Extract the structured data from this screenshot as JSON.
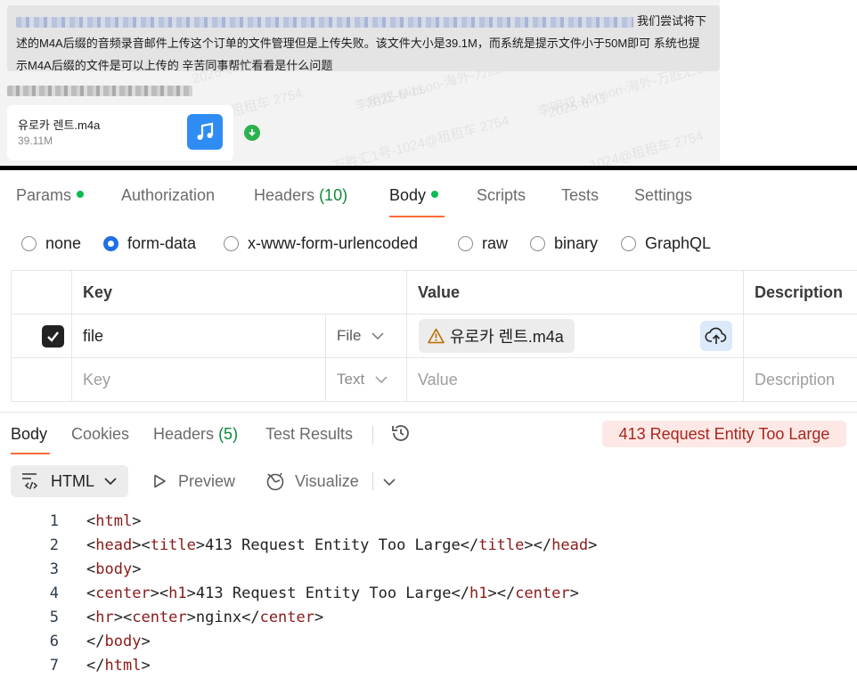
{
  "chat": {
    "message_text_line1": "我们尝试将下",
    "message_text_line2": "述的M4A后缀的音频录音邮件上传这个订单的文件管理但是上传失败。该文件大小是39.1M，而系统是提示文件小于50M即可 系统也提",
    "message_text_line3": "示M4A后缀的文件是可以上传的 辛苦同事帮忙看看是什么问题",
    "attachment": {
      "file_name": "유로카 렌트.m4a",
      "file_size": "39.11M",
      "icon": "music-note-icon",
      "download_icon": "download-icon"
    },
    "watermarks": [
      "李明双-Minson-海外-万胜汇1号",
      "2025-6-11",
      "万胜汇1号-1024@租租车 2754",
      "1024@租租车 2754"
    ]
  },
  "request": {
    "tabs": [
      {
        "label": "Params",
        "count": "",
        "dot": true,
        "active": false
      },
      {
        "label": "Authorization",
        "count": "",
        "dot": false,
        "active": false
      },
      {
        "label": "Headers",
        "count": "(10)",
        "dot": false,
        "active": false
      },
      {
        "label": "Body",
        "count": "",
        "dot": true,
        "active": true
      },
      {
        "label": "Scripts",
        "count": "",
        "dot": false,
        "active": false
      },
      {
        "label": "Tests",
        "count": "",
        "dot": false,
        "active": false
      },
      {
        "label": "Settings",
        "count": "",
        "dot": false,
        "active": false
      }
    ],
    "body_types": [
      {
        "label": "none",
        "selected": false
      },
      {
        "label": "form-data",
        "selected": true
      },
      {
        "label": "x-www-form-urlencoded",
        "selected": false
      },
      {
        "label": "raw",
        "selected": false
      },
      {
        "label": "binary",
        "selected": false
      },
      {
        "label": "GraphQL",
        "selected": false
      }
    ],
    "table": {
      "headers": {
        "key": "Key",
        "value": "Value",
        "description": "Description"
      },
      "rows": [
        {
          "checked": true,
          "key": "file",
          "type": "File",
          "value": "유로카 렌트.m4a",
          "value_icon": "warning-icon",
          "description": ""
        }
      ],
      "new_row": {
        "key_placeholder": "Key",
        "type": "Text",
        "value_placeholder": "Value",
        "description_placeholder": "Description"
      }
    }
  },
  "response": {
    "tabs": [
      {
        "label": "Body",
        "count": "",
        "active": true
      },
      {
        "label": "Cookies",
        "count": "",
        "active": false
      },
      {
        "label": "Headers",
        "count": "(5)",
        "active": false
      },
      {
        "label": "Test Results",
        "count": "",
        "active": false
      }
    ],
    "status": "413 Request Entity Too Large",
    "status_color": "#a8261d",
    "format": "HTML",
    "preview_label": "Preview",
    "visualize_label": "Visualize",
    "code_lines": [
      {
        "n": "1",
        "parts": [
          [
            "t",
            "<html>"
          ]
        ]
      },
      {
        "n": "2",
        "parts": [
          [
            "t",
            "<head><title>"
          ],
          [
            "x",
            "413 Request Entity Too Large"
          ],
          [
            "t",
            "</title></head>"
          ]
        ]
      },
      {
        "n": "3",
        "parts": [
          [
            "t",
            "<body>"
          ]
        ]
      },
      {
        "n": "4",
        "parts": [
          [
            "t",
            "<center><h1>"
          ],
          [
            "x",
            "413 Request Entity Too Large"
          ],
          [
            "t",
            "</h1></center>"
          ]
        ]
      },
      {
        "n": "5",
        "parts": [
          [
            "t",
            "<hr><center>"
          ],
          [
            "x",
            "nginx"
          ],
          [
            "t",
            "</center>"
          ]
        ]
      },
      {
        "n": "6",
        "parts": [
          [
            "t",
            "</body>"
          ]
        ]
      },
      {
        "n": "7",
        "parts": [
          [
            "t",
            "</html>"
          ]
        ]
      }
    ]
  },
  "colors": {
    "accent": "#ff6c37",
    "radio_selected": "#1f6fe5",
    "count_green": "#0e8a3b",
    "dot_green": "#0cbb52",
    "code_tag": "#8b1a1a"
  }
}
